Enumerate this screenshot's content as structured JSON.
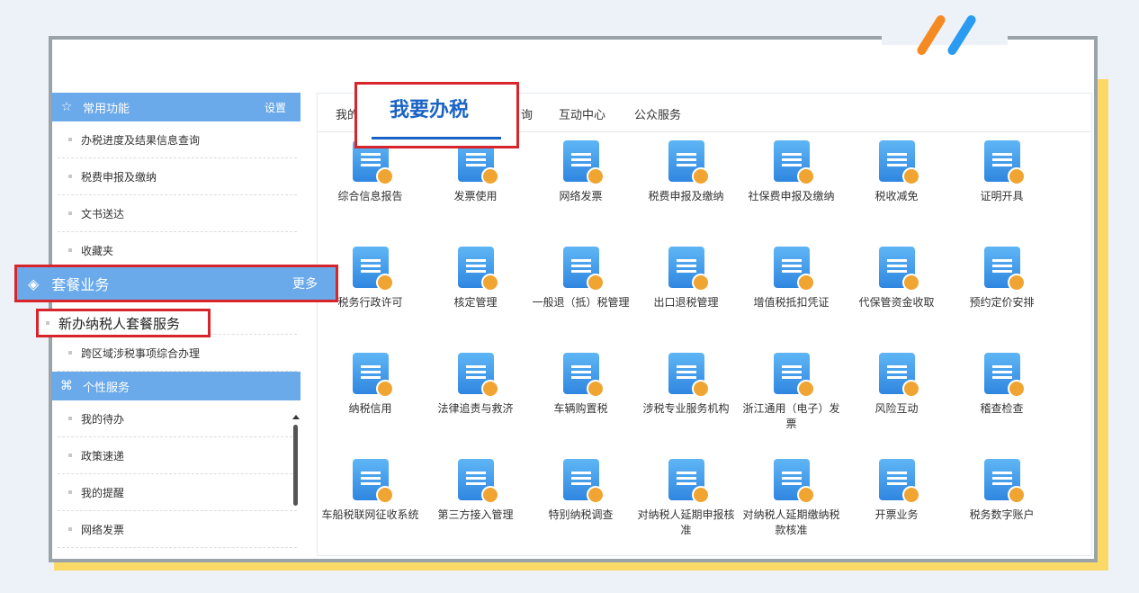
{
  "sidebar": {
    "group1": {
      "title": "常用功能",
      "action": "设置",
      "items": [
        "办税进度及结果信息查询",
        "税费申报及缴纳",
        "文书送达",
        "收藏夹"
      ]
    },
    "group2": {
      "title": "套餐业务",
      "action": "更多",
      "items": [
        "新办纳税人套餐服务",
        "跨区域涉税事项综合办理"
      ]
    },
    "group3": {
      "title": "个性服务",
      "items": [
        "我的待办",
        "政策速递",
        "我的提醒",
        "网络发票"
      ]
    }
  },
  "tabs": {
    "partial_first": "我的",
    "active": "我要办税",
    "partial_query": "询",
    "interaction": "互动中心",
    "public": "公众服务"
  },
  "services": [
    "综合信息报告",
    "发票使用",
    "网络发票",
    "税费申报及缴纳",
    "社保费申报及缴纳",
    "税收减免",
    "证明开具",
    "税务行政许可",
    "核定管理",
    "一般退（抵）税管理",
    "出口退税管理",
    "增值税抵扣凭证",
    "代保管资金收取",
    "预约定价安排",
    "纳税信用",
    "法律追责与救济",
    "车辆购置税",
    "涉税专业服务机构",
    "浙江通用（电子）发票",
    "风险互动",
    "稽查检查",
    "车船税联网征收系统",
    "第三方接入管理",
    "特别纳税调查",
    "对纳税人延期申报核准",
    "对纳税人延期缴纳税款核准",
    "开票业务",
    "税务数字账户"
  ],
  "icons": {
    "group1": "star-icon",
    "group2": "layers-icon",
    "group3": "grid-icon",
    "services": [
      "report-icon",
      "printer-icon",
      "card-icon",
      "declare-upload-icon",
      "form-pen-icon",
      "clipboard-icon",
      "certificate-icon",
      "binders-icon",
      "edit-doc-icon",
      "refund-badge-icon",
      "ship-exchange-icon",
      "yen-voucher-icon",
      "hand-coin-icon",
      "calendar-clock-icon",
      "credit-icon",
      "justice-person-icon",
      "car-clipboard-icon",
      "heart-hand-icon",
      "board-doc-icon",
      "shield-bolt-icon",
      "monitor-chart-icon",
      "ship-tax-icon",
      "server-rack-icon",
      "doc-search-icon",
      "books-search-icon",
      "calendar-doc-icon",
      "printer-icon",
      "doc-zoom-icon"
    ]
  },
  "colors": {
    "accent": "#6aa9ea",
    "highlight": "#d7252b",
    "tab_active": "#1a63c5",
    "shadow": "#fbd967",
    "frame": "#9aa3a8",
    "slash1": "#f58a22",
    "slash2": "#2a9bf0"
  }
}
